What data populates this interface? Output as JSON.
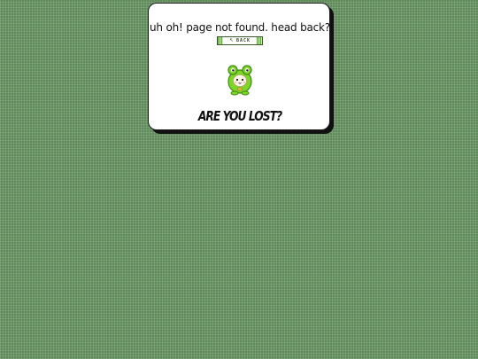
{
  "page": {
    "background_color": "#5e8a5a"
  },
  "card": {
    "message": "uh oh! page not found. head back?",
    "back_button": {
      "arrow": "↖",
      "label": "BACK"
    },
    "mascot_icon": "frog-mascot-icon",
    "lost_text": "ARE YOU LOST?"
  }
}
